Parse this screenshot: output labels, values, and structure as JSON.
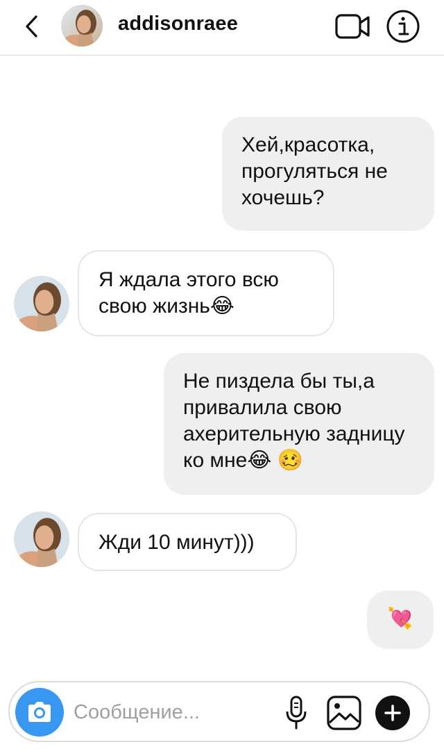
{
  "header": {
    "username": "addisonraee",
    "back_icon": "chevron-left-icon",
    "video_icon": "video-camera-icon",
    "info_icon": "info-icon"
  },
  "messages": [
    {
      "sender": "me",
      "text": "Хей,красотка, прогуляться не хочешь?"
    },
    {
      "sender": "them",
      "text": "Я ждала этого всю свою жизнь😂"
    },
    {
      "sender": "me",
      "text": "Не пиздела бы ты,а привалила свою ахерительную задницу ко мне😂 🥴"
    },
    {
      "sender": "them",
      "text": "Жди 10 минут)))"
    },
    {
      "sender": "me",
      "text": "💘"
    }
  ],
  "composer": {
    "placeholder": "Сообщение...",
    "camera_icon": "camera-icon",
    "mic_icon": "microphone-icon",
    "gallery_icon": "image-gallery-icon",
    "plus_icon": "plus-icon"
  },
  "colors": {
    "my_bubble": "#efefef",
    "their_bubble_border": "#e6e6e6",
    "camera_button": "#3897f0",
    "divider": "#dbdbdb"
  }
}
